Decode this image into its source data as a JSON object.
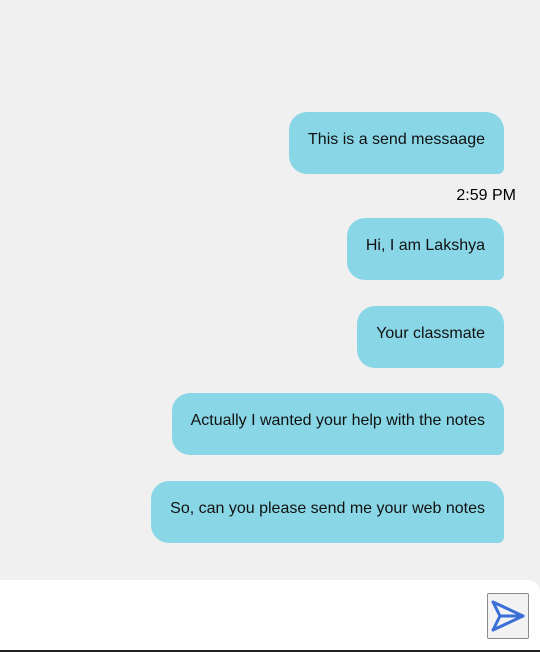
{
  "messages": [
    {
      "text": "This is a send messaage"
    },
    {
      "text": "Hi, I am Lakshya"
    },
    {
      "text": "Your classmate"
    },
    {
      "text": "Actually I wanted your help with the notes"
    },
    {
      "text": "So, can you please send me your web notes"
    }
  ],
  "timestamp": "2:59 PM",
  "composer": {
    "placeholder": "",
    "value": "",
    "send_icon": "send-icon"
  },
  "colors": {
    "background": "#f0f0f0",
    "bubble": "#89d7e6",
    "send_icon": "#3a6fd8"
  }
}
